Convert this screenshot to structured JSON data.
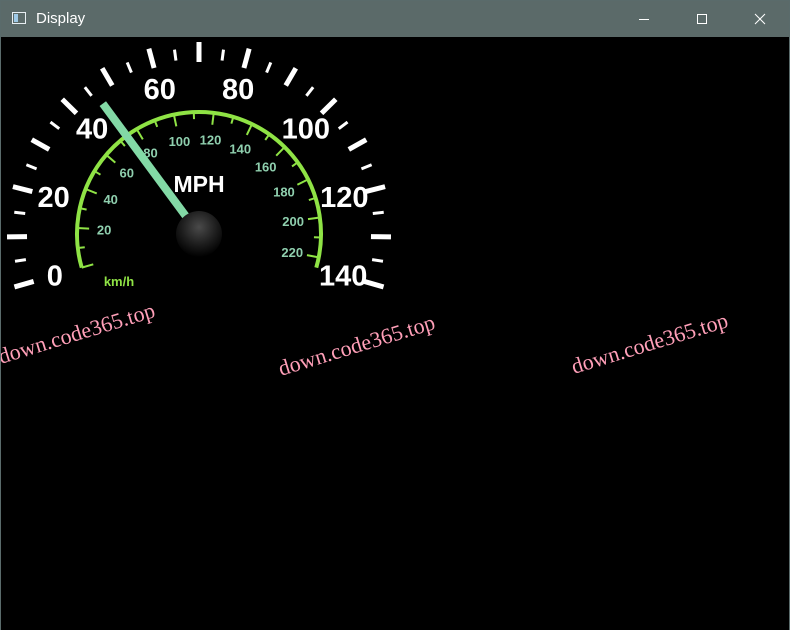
{
  "window": {
    "title": "Display",
    "controls": {
      "minimize": "minimize-icon",
      "maximize": "maximize-icon",
      "close": "close-icon"
    }
  },
  "gauge": {
    "outer_unit": "MPH",
    "outer_labels": [
      "0",
      "20",
      "40",
      "60",
      "80",
      "100",
      "120",
      "140"
    ],
    "inner_unit": "km/h",
    "inner_labels": [
      "20",
      "40",
      "60",
      "80",
      "100",
      "120",
      "140",
      "160",
      "180",
      "200",
      "220"
    ],
    "needle_value_mph": 40,
    "colors": {
      "outer_ticks": "#ffffff",
      "inner_ring": "#8fe345",
      "inner_labels": "#8fcfae",
      "needle": "#83d9a6",
      "unit_label": "#ffffff"
    }
  },
  "watermarks": [
    "down.code365.top",
    "down.code365.top",
    "down.code365.top"
  ]
}
